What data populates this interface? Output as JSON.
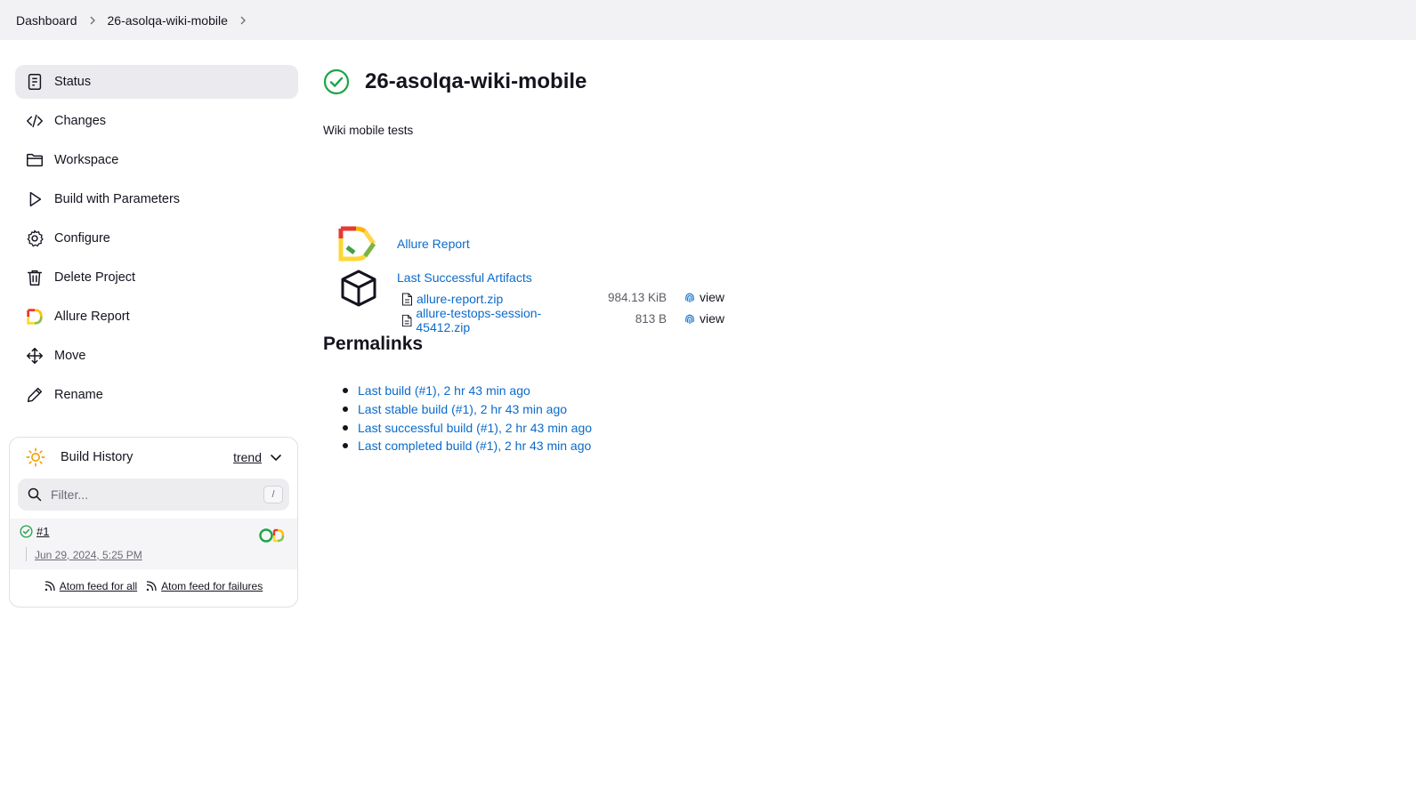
{
  "breadcrumb": {
    "items": [
      "Dashboard",
      "26-asolqa-wiki-mobile"
    ]
  },
  "sidebar": {
    "items": [
      {
        "label": "Status",
        "icon": "status-document-icon",
        "active": true
      },
      {
        "label": "Changes",
        "icon": "code-icon"
      },
      {
        "label": "Workspace",
        "icon": "folder-icon"
      },
      {
        "label": "Build with Parameters",
        "icon": "play-icon"
      },
      {
        "label": "Configure",
        "icon": "gear-icon"
      },
      {
        "label": "Delete Project",
        "icon": "trash-icon"
      },
      {
        "label": "Allure Report",
        "icon": "allure-icon"
      },
      {
        "label": "Move",
        "icon": "move-icon"
      },
      {
        "label": "Rename",
        "icon": "pencil-icon"
      }
    ]
  },
  "build_history": {
    "title": "Build History",
    "trend_label": "trend",
    "filter_placeholder": "Filter...",
    "filter_shortcut": "/",
    "builds": [
      {
        "number": "#1",
        "date": "Jun 29, 2024, 5:25 PM",
        "status": "success"
      }
    ],
    "feeds": {
      "all": "Atom feed for all",
      "failures": "Atom feed for failures"
    }
  },
  "main": {
    "title": "26-asolqa-wiki-mobile",
    "description": "Wiki mobile tests",
    "allure_link": "Allure Report",
    "artifacts": {
      "heading": "Last Successful Artifacts",
      "files": [
        {
          "name": "allure-report.zip",
          "size": "984.13 KiB",
          "view": "view"
        },
        {
          "name": "allure-testops-session-45412.zip",
          "size": "813 B",
          "view": "view"
        }
      ]
    },
    "permalinks_heading": "Permalinks",
    "permalinks": [
      "Last build (#1), 2 hr 43 min ago",
      "Last stable build (#1), 2 hr 43 min ago",
      "Last successful build (#1), 2 hr 43 min ago",
      "Last completed build (#1), 2 hr 43 min ago"
    ]
  },
  "colors": {
    "link": "#0b6bcb",
    "success": "#1ea446",
    "sidebar_active": "#ebebef",
    "topbar": "#f2f2f5"
  }
}
